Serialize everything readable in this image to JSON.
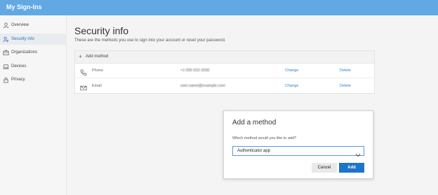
{
  "header": {
    "app_title": "My Sign-Ins",
    "background_color": "#62a9e4"
  },
  "sidebar": {
    "items": [
      {
        "label": "Overview",
        "icon": "user-icon",
        "active": false
      },
      {
        "label": "Security info",
        "icon": "user-key-icon",
        "active": true
      },
      {
        "label": "Organizations",
        "icon": "building-icon",
        "active": false
      },
      {
        "label": "Devices",
        "icon": "laptop-icon",
        "active": false
      },
      {
        "label": "Privacy",
        "icon": "lock-icon",
        "active": false
      }
    ]
  },
  "main": {
    "title": "Security info",
    "subtitle": "These are the methods you use to sign into your account or reset your password.",
    "add_method_label": "Add method",
    "methods": [
      {
        "name": "Phone",
        "icon": "phone-icon",
        "value": "+1 555 010 2030",
        "change_label": "Change",
        "delete_label": "Delete"
      },
      {
        "name": "Email",
        "icon": "mail-icon",
        "value": "user.name@example.com",
        "change_label": "Change",
        "delete_label": "Delete"
      }
    ]
  },
  "dialog": {
    "title": "Add a method",
    "prompt": "Which method would you like to add?",
    "selected_method": "Authenticator app",
    "cancel_label": "Cancel",
    "add_label": "Add",
    "accent_color": "#1e74c9"
  }
}
